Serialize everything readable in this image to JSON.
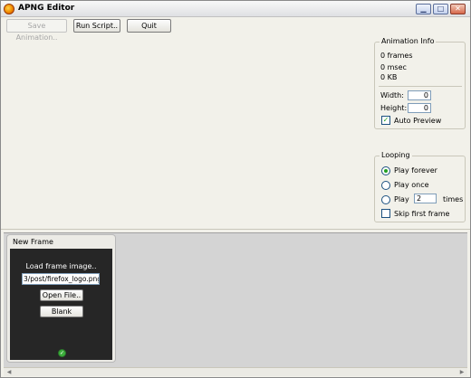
{
  "window": {
    "title": "APNG Editor",
    "controls": {
      "minimize": "▁",
      "maximize": "□",
      "close": "✕"
    }
  },
  "toolbar": {
    "save_label": "Save Animation..",
    "run_label": "Run Script..",
    "quit_label": "Quit"
  },
  "animation_info": {
    "legend": "Animation Info",
    "frames": "0 frames",
    "duration": "0 msec",
    "size": "0 KB",
    "width_label": "Width:",
    "width_value": "0",
    "height_label": "Height:",
    "height_value": "0",
    "auto_preview_label": "Auto Preview",
    "auto_preview_checked": true
  },
  "looping": {
    "legend": "Looping",
    "option_forever": "Play forever",
    "option_once": "Play once",
    "option_times_prefix": "Play",
    "times_value": "2",
    "option_times_suffix": "times",
    "selected": "forever",
    "skip_first_label": "Skip first frame",
    "skip_first_checked": false
  },
  "frames": {
    "card_title": "New Frame",
    "load_label": "Load frame image..",
    "path_value": "3/post/firefox_logo.png",
    "open_file_label": "Open File..",
    "blank_label": "Blank",
    "status_icon": "check-icon"
  },
  "colors": {
    "window_bg": "#f2f1ea",
    "frames_bg": "#d4d4d4",
    "canvas_bg": "#262626",
    "accent_green": "#3cae3c"
  }
}
